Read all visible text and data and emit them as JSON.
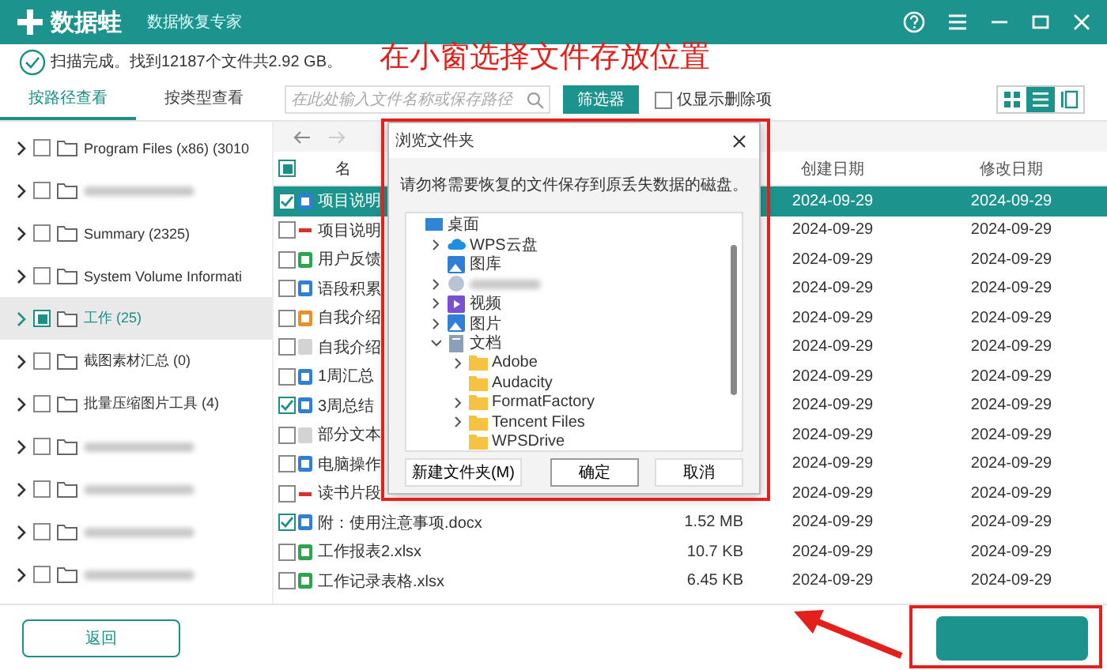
{
  "app": {
    "name": "数据蛙",
    "subtitle": "数据恢复专家"
  },
  "status": "扫描完成。找到12187个文件共2.92 GB。",
  "annotation": {
    "title": "在小窗选择文件存放位置"
  },
  "tabs": [
    {
      "label": "按路径查看",
      "selected": true
    },
    {
      "label": "按类型查看",
      "selected": false
    }
  ],
  "search": {
    "placeholder": "在此处输入文件名称或保存路径"
  },
  "filter_button": "筛选器",
  "deleted_only": {
    "label": "仅显示删除项",
    "checked": false
  },
  "view_modes": [
    {
      "kind": "grid",
      "selected": false
    },
    {
      "kind": "list",
      "selected": true
    },
    {
      "kind": "detail",
      "selected": false
    }
  ],
  "sidebar": {
    "items": [
      {
        "kind": "folder",
        "label": "Program Files (x86) (3010",
        "partial": false,
        "selected": false
      },
      {
        "kind": "blurred",
        "partial": false,
        "selected": false
      },
      {
        "kind": "folder",
        "label": "Summary (2325)",
        "partial": false,
        "selected": false
      },
      {
        "kind": "folder",
        "label": "System Volume Informati",
        "partial": false,
        "selected": false
      },
      {
        "kind": "folder",
        "label": "工作 (25)",
        "partial": true,
        "selected": true
      },
      {
        "kind": "folder",
        "label": "截图素材汇总 (0)",
        "partial": false,
        "selected": false
      },
      {
        "kind": "folder",
        "label": "批量压缩图片工具 (4)",
        "partial": false,
        "selected": false
      },
      {
        "kind": "blurred",
        "partial": false,
        "selected": false
      },
      {
        "kind": "blurred",
        "partial": false,
        "selected": false
      },
      {
        "kind": "blurred",
        "partial": false,
        "selected": false
      },
      {
        "kind": "blurred",
        "partial": false,
        "selected": false
      }
    ]
  },
  "table": {
    "select_all": {
      "partial": true
    },
    "columns": [
      "名",
      "创建日期",
      "修改日期"
    ],
    "rows": [
      {
        "kind": "word",
        "name": "项目说明",
        "checked": true,
        "selected": true,
        "created": "2024-09-29",
        "modified": "2024-09-29"
      },
      {
        "kind": "pdf",
        "name": "项目说明",
        "checked": false,
        "selected": false,
        "created": "2024-09-29",
        "modified": "2024-09-29"
      },
      {
        "kind": "excel",
        "name": "用户反馈",
        "checked": false,
        "selected": false,
        "created": "2024-09-29",
        "modified": "2024-09-29"
      },
      {
        "kind": "word",
        "name": "语段积累",
        "checked": false,
        "selected": false,
        "created": "2024-09-29",
        "modified": "2024-09-29"
      },
      {
        "kind": "slides",
        "name": "自我介绍",
        "checked": false,
        "selected": false,
        "created": "2024-09-29",
        "modified": "2024-09-29"
      },
      {
        "kind": "text",
        "name": "自我介绍",
        "checked": false,
        "selected": false,
        "created": "2024-09-29",
        "modified": "2024-09-29"
      },
      {
        "kind": "word",
        "name": "1周汇总",
        "checked": false,
        "selected": false,
        "created": "2024-09-29",
        "modified": "2024-09-29"
      },
      {
        "kind": "word",
        "name": "3周总结",
        "checked": true,
        "selected": false,
        "created": "2024-09-29",
        "modified": "2024-09-29"
      },
      {
        "kind": "text",
        "name": "部分文本",
        "checked": false,
        "selected": false,
        "created": "2024-09-29",
        "modified": "2024-09-29"
      },
      {
        "kind": "word",
        "name": "电脑操作",
        "checked": false,
        "selected": false,
        "created": "2024-09-29",
        "modified": "2024-09-29"
      },
      {
        "kind": "pdf",
        "name": "读书片段",
        "checked": false,
        "selected": false,
        "created": "2024-09-29",
        "modified": "2024-09-29"
      },
      {
        "kind": "word",
        "name": "附：使用注意事项.docx",
        "size": "1.52 MB",
        "checked": true,
        "selected": false,
        "created": "2024-09-29",
        "modified": "2024-09-29"
      },
      {
        "kind": "excel",
        "name": "工作报表2.xlsx",
        "size": "10.7 KB",
        "checked": false,
        "selected": false,
        "created": "2024-09-29",
        "modified": "2024-09-29"
      },
      {
        "kind": "excel",
        "name": "工作记录表格.xlsx",
        "size": "6.45 KB",
        "checked": false,
        "selected": false,
        "created": "2024-09-29",
        "modified": "2024-09-29"
      }
    ]
  },
  "dialog": {
    "title": "浏览文件夹",
    "message": "请勿将需要恢复的文件保存到原丢失数据的磁盘。",
    "tree": [
      {
        "label": "桌面",
        "kind": "desktop",
        "children": [
          {
            "label": "WPS云盘",
            "kind": "cloud",
            "expanded": false
          },
          {
            "label": "图库",
            "kind": "gallery"
          },
          {
            "kind": "blurred",
            "expanded": false
          },
          {
            "label": "视频",
            "kind": "video",
            "expanded": false
          },
          {
            "label": "图片",
            "kind": "gallery",
            "expanded": false
          },
          {
            "label": "文档",
            "kind": "document",
            "expanded": true,
            "children": [
              {
                "label": "Adobe",
                "kind": "folder",
                "expanded": false
              },
              {
                "label": "Audacity",
                "kind": "folder"
              },
              {
                "label": "FormatFactory",
                "kind": "folder",
                "expanded": false
              },
              {
                "label": "Tencent Files",
                "kind": "folder",
                "expanded": false
              },
              {
                "label": "WPSDrive",
                "kind": "folder"
              }
            ]
          }
        ]
      }
    ],
    "buttons": [
      {
        "label": "新建文件夹(M)",
        "default": false
      },
      {
        "label": "确定",
        "default": true
      },
      {
        "label": "取消",
        "default": false
      }
    ]
  },
  "footer": {
    "back_button": "返回"
  }
}
